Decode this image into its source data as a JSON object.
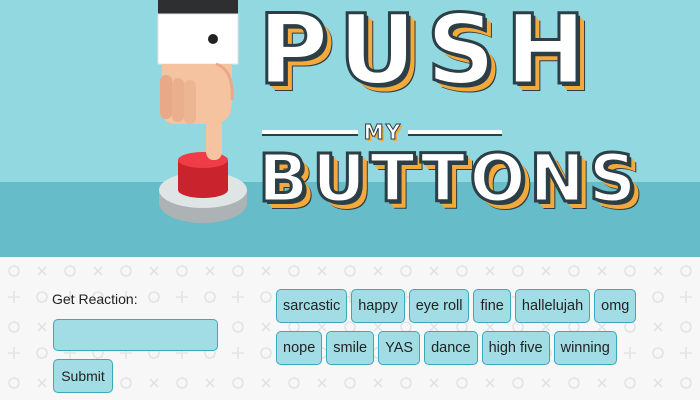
{
  "logo": {
    "line1": "PUSH",
    "line2": "MY",
    "line3": "BUTTONS"
  },
  "form": {
    "label": "Get Reaction:",
    "input_value": "",
    "submit_label": "Submit"
  },
  "reactions": {
    "row1": [
      "sarcastic",
      "happy",
      "eye roll",
      "fine",
      "hallelujah",
      "omg"
    ],
    "row2": [
      "nope",
      "smile",
      "YAS",
      "dance",
      "high five",
      "winning"
    ]
  },
  "colors": {
    "sky": "#92d8e1",
    "floor": "#66bcc8",
    "button_fill": "#a2dde5",
    "button_border": "#3aa9b8",
    "logo_accent": "#f4a93b",
    "logo_outline": "#2c3e46",
    "red_button": "#e8313a"
  }
}
